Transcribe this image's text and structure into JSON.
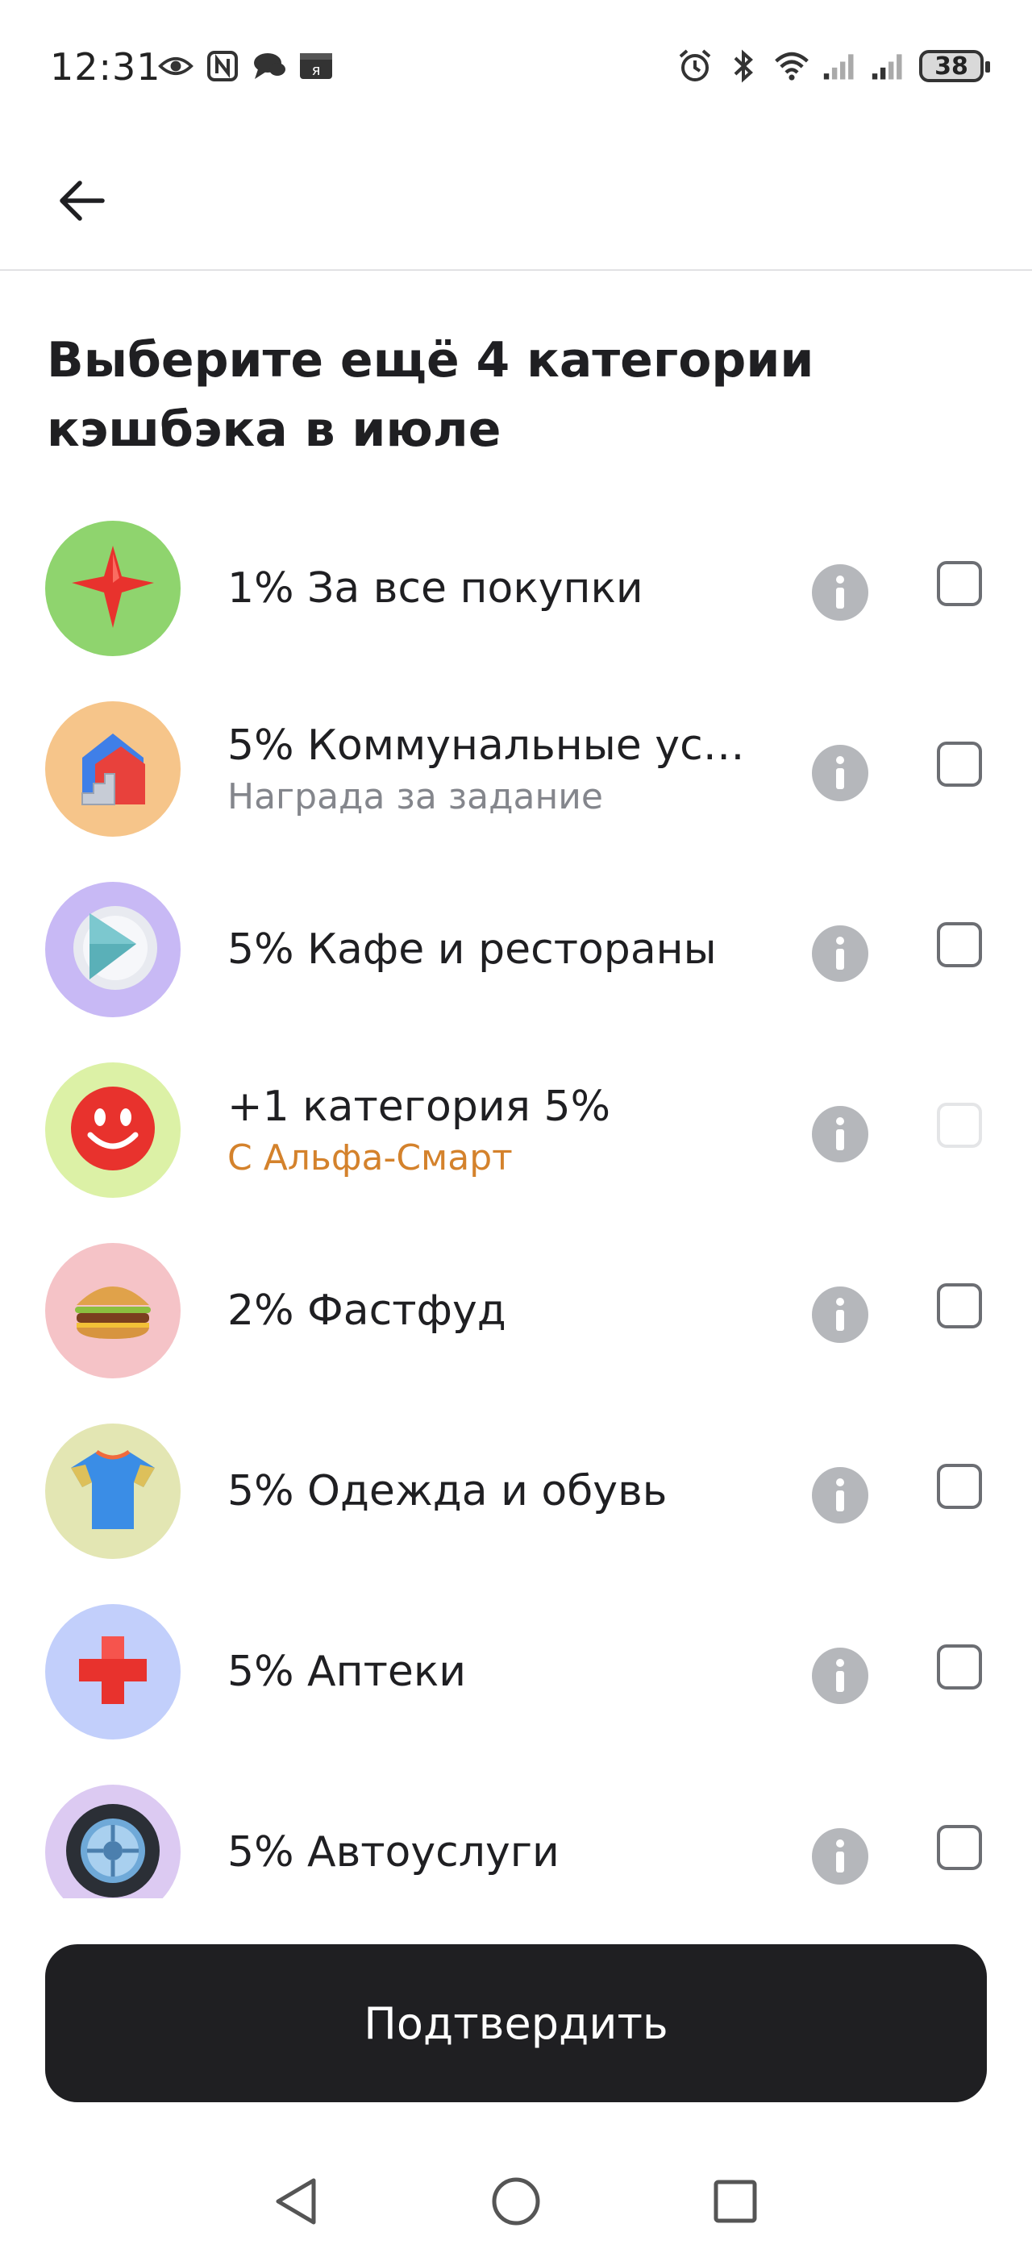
{
  "status_bar": {
    "time": "12:31",
    "battery": "38",
    "left_icons": [
      "eye-icon",
      "nfc-icon",
      "chat-icon",
      "yandex-icon"
    ],
    "right_icons": [
      "alarm-icon",
      "bluetooth-icon",
      "wifi-icon",
      "signal-icon",
      "signal-icon"
    ]
  },
  "app_bar": {
    "back_icon": "arrow-left-icon"
  },
  "page": {
    "title": "Выберите ещё 4 категории кэшбэка в июле"
  },
  "categories": [
    {
      "title": "1% За все покупки",
      "subtitle": "",
      "icon": "red-star-icon",
      "bg": "#8fd46e",
      "checked": false,
      "disabled": false
    },
    {
      "title": "5% Коммунальные усл...",
      "subtitle": "Награда за задание",
      "icon": "house-icon",
      "bg": "#f6c58a",
      "checked": false,
      "disabled": false
    },
    {
      "title": "5% Кафе и рестораны",
      "subtitle": "",
      "icon": "plate-icon",
      "bg": "#c8b9f5",
      "checked": false,
      "disabled": false
    },
    {
      "title": "+1 категория 5%",
      "subtitle": "С Альфа-Смарт",
      "icon": "smiley-icon",
      "bg": "#dcf1a6",
      "checked": false,
      "disabled": true
    },
    {
      "title": "2% Фастфуд",
      "subtitle": "",
      "icon": "burger-icon",
      "bg": "#f5c3c7",
      "checked": false,
      "disabled": false
    },
    {
      "title": "5% Одежда и обувь",
      "subtitle": "",
      "icon": "tshirt-icon",
      "bg": "#e3e6b3",
      "checked": false,
      "disabled": false
    },
    {
      "title": "5% Аптеки",
      "subtitle": "",
      "icon": "medical-cross-icon",
      "bg": "#c2cffb",
      "checked": false,
      "disabled": false
    },
    {
      "title": "5% Автоуслуги",
      "subtitle": "",
      "icon": "wheel-icon",
      "bg": "#dccaf2",
      "checked": false,
      "disabled": false
    }
  ],
  "colors": {
    "accent_orange": "#d4822c",
    "button_dark": "#1f1f22",
    "info_grey": "#b5b7bb"
  },
  "actions": {
    "confirm_label": "Подтвердить"
  },
  "nav_bar": {
    "icons": [
      "back-triangle-icon",
      "home-circle-icon",
      "recents-square-icon"
    ]
  }
}
